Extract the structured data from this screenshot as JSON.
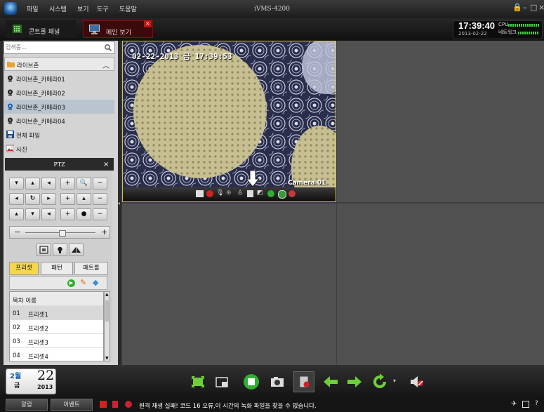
{
  "app": {
    "title": "iVMS-4200",
    "menu": [
      "파일",
      "시스템",
      "보기",
      "도구",
      "도움말"
    ],
    "window_controls": [
      "🔒",
      "–",
      "□",
      "×"
    ]
  },
  "tabs": [
    {
      "label": "콘트롤 패널"
    },
    {
      "label": "메인 보기",
      "close": "×"
    }
  ],
  "status_clock": {
    "time": "17:39:40",
    "date": "2013-02-22",
    "cpu_label": "CPU",
    "network_label": "네트워크"
  },
  "search": {
    "placeholder": "검색중..."
  },
  "tree": {
    "group": "라이브존",
    "cameras": [
      "라이브존_카메라01",
      "라이브존_카메라02",
      "라이브존_카메라03",
      "라이브존_카메라04"
    ],
    "selected_index": 2,
    "all_files": "전체 파일",
    "pictures": "사진"
  },
  "ptz": {
    "title": "PTZ",
    "close": "×",
    "tabs": [
      "프리셋",
      "패턴",
      "패트롤"
    ],
    "active_tab": 0,
    "list_header": "목차 이름",
    "presets": [
      {
        "num": "01",
        "name": "프리셋1"
      },
      {
        "num": "02",
        "name": "프리셋2"
      },
      {
        "num": "03",
        "name": "프리셋3"
      },
      {
        "num": "04",
        "name": "프리셋4"
      }
    ]
  },
  "video": {
    "osd_time": "02-22-2013 금 17:39:53",
    "camera_label": "Camera 01"
  },
  "date_widget": {
    "month": "2월",
    "weekday": "금",
    "day": "22",
    "year": "2013"
  },
  "statusbar": {
    "alarm_label": "알람",
    "event_label": "이벤트",
    "message": "원격 재생 실패! 코드 16 오류,이 시간의 녹화 파일을 찾을 수 없습니다."
  },
  "colors": {
    "accent_active_tab": "#c81010",
    "selection_highlight": "#d6c442",
    "ptz_active_tab": "#f5d84a",
    "toolbar_green": "#3fd13f"
  }
}
